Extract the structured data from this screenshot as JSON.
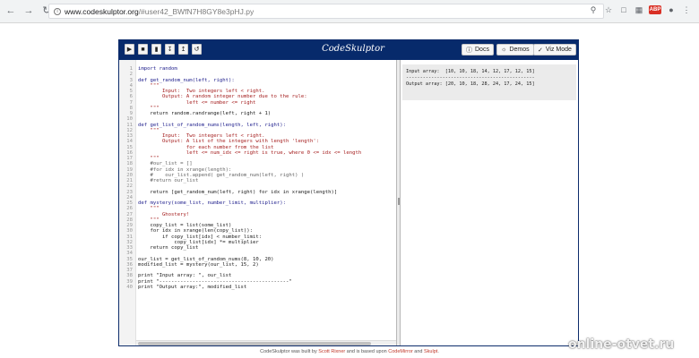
{
  "browser": {
    "url_host": "www.codeskulptor.org",
    "url_path": "/#user42_BWfN7H8GY8e3pHJ.py",
    "ext_badge": "ABP"
  },
  "app": {
    "title": "CodeSkulptor",
    "toolbar_icons": [
      "play-icon",
      "stop-icon",
      "save-icon",
      "download-icon",
      "upload-icon",
      "reset-icon"
    ],
    "docs_label": "Docs",
    "demos_label": "Demos",
    "vizmode_label": "Viz Mode"
  },
  "code": [
    {
      "n": "1",
      "t": "import random",
      "c": "kw"
    },
    {
      "n": "2",
      "t": "",
      "c": ""
    },
    {
      "n": "3",
      "t": "def get_random_num(left, right):",
      "c": "kw"
    },
    {
      "n": "4",
      "t": "    \"\"\"",
      "c": "str"
    },
    {
      "n": "5",
      "t": "        Input:  Two integers left < right.",
      "c": "str"
    },
    {
      "n": "6",
      "t": "        Output: A random integer number due to the rule:",
      "c": "str"
    },
    {
      "n": "7",
      "t": "                left <= number <= right",
      "c": "str"
    },
    {
      "n": "8",
      "t": "    \"\"\"",
      "c": "str"
    },
    {
      "n": "9",
      "t": "    return random.randrange(left, right + 1)",
      "c": ""
    },
    {
      "n": "10",
      "t": "",
      "c": ""
    },
    {
      "n": "11",
      "t": "def get_list_of_random_nums(length, left, right):",
      "c": "kw"
    },
    {
      "n": "12",
      "t": "    \"\"\"",
      "c": "str"
    },
    {
      "n": "13",
      "t": "        Input:  Two integers left < right.",
      "c": "str"
    },
    {
      "n": "14",
      "t": "        Output: A list of the integers with length 'length':",
      "c": "str"
    },
    {
      "n": "15",
      "t": "                for each number from the list",
      "c": "str"
    },
    {
      "n": "16",
      "t": "                left <= num_idx <= right is true, where 0 <= idx <= length",
      "c": "str"
    },
    {
      "n": "17",
      "t": "    \"\"\"",
      "c": "str"
    },
    {
      "n": "18",
      "t": "    #our_list = []",
      "c": "cm"
    },
    {
      "n": "19",
      "t": "    #for idx in xrange(length):",
      "c": "cm"
    },
    {
      "n": "20",
      "t": "    #    our_list.append( get_random_num(left, right) )",
      "c": "cm"
    },
    {
      "n": "21",
      "t": "    #return our_list",
      "c": "cm"
    },
    {
      "n": "22",
      "t": "",
      "c": ""
    },
    {
      "n": "23",
      "t": "    return [get_random_num(left, right) for idx in xrange(length)]",
      "c": ""
    },
    {
      "n": "24",
      "t": "",
      "c": ""
    },
    {
      "n": "25",
      "t": "def mystery(some_list, number_limit, multiplier):",
      "c": "kw"
    },
    {
      "n": "26",
      "t": "    \"\"\"",
      "c": "str"
    },
    {
      "n": "27",
      "t": "        Ghostery!",
      "c": "str"
    },
    {
      "n": "28",
      "t": "    \"\"\"",
      "c": "str"
    },
    {
      "n": "29",
      "t": "    copy_list = list(some_list)",
      "c": ""
    },
    {
      "n": "30",
      "t": "    for idx in xrange(len(copy_list)):",
      "c": ""
    },
    {
      "n": "31",
      "t": "        if copy_list[idx] < number_limit:",
      "c": ""
    },
    {
      "n": "32",
      "t": "            copy_list[idx] *= multiplier",
      "c": ""
    },
    {
      "n": "33",
      "t": "    return copy_list",
      "c": ""
    },
    {
      "n": "34",
      "t": "",
      "c": ""
    },
    {
      "n": "35",
      "t": "our_list = get_list_of_random_nums(8, 10, 20)",
      "c": ""
    },
    {
      "n": "36",
      "t": "modified_list = mystery(our_list, 15, 2)",
      "c": ""
    },
    {
      "n": "37",
      "t": "",
      "c": ""
    },
    {
      "n": "38",
      "t": "print \"Input array: \", our_list",
      "c": ""
    },
    {
      "n": "39",
      "t": "print \"-------------------------------------------\"",
      "c": ""
    },
    {
      "n": "40",
      "t": "print \"Output array:\", modified_list",
      "c": ""
    }
  ],
  "output": [
    "Input array:  [10, 10, 18, 14, 12, 17, 12, 15]",
    "----------------------------------------------",
    "Output array: [20, 10, 18, 28, 24, 17, 24, 15]"
  ],
  "footer": {
    "prefix": "CodeSkulptor was built by ",
    "author": "Scott Rixner",
    "middle": " and is based upon ",
    "lib1": "CodeMirror",
    "and": " and ",
    "lib2": "Skulpt",
    "suffix": "."
  },
  "watermark": "online-otvet.ru"
}
